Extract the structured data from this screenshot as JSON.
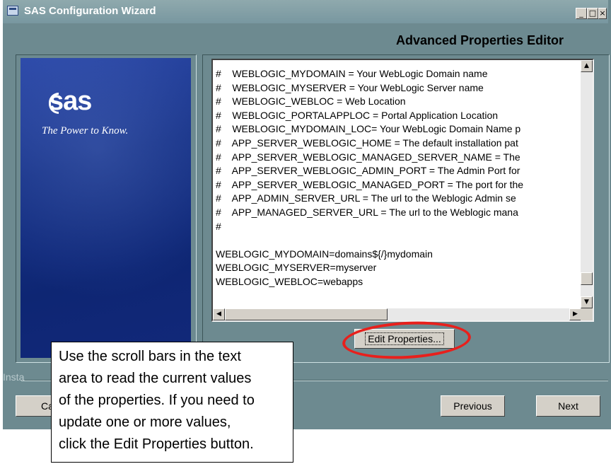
{
  "window": {
    "title": "SAS Configuration Wizard",
    "controls": {
      "minimize": "_",
      "maximize": "□",
      "close": "×"
    }
  },
  "header": {
    "title": "Advanced Properties Editor"
  },
  "banner": {
    "logo_text": "sas",
    "tagline": "The Power to Know."
  },
  "properties_text": {
    "lines": [
      "#    WEBLOGIC_MYDOMAIN = Your WebLogic Domain name",
      "#    WEBLOGIC_MYSERVER = Your WebLogic Server name",
      "#    WEBLOGIC_WEBLOC = Web Location",
      "#    WEBLOGIC_PORTALAPPLOC = Portal Application Location",
      "#    WEBLOGIC_MYDOMAIN_LOC= Your WebLogic Domain Name p",
      "#    APP_SERVER_WEBLOGIC_HOME = The default installation pat",
      "#    APP_SERVER_WEBLOGIC_MANAGED_SERVER_NAME = The",
      "#    APP_SERVER_WEBLOGIC_ADMIN_PORT = The Admin Port for",
      "#    APP_SERVER_WEBLOGIC_MANAGED_PORT = The port for the",
      "#    APP_ADMIN_SERVER_URL = The url to the Weblogic Admin se",
      "#    APP_MANAGED_SERVER_URL = The url to the Weblogic mana",
      "#",
      "",
      "WEBLOGIC_MYDOMAIN=domains${/}mydomain",
      "WEBLOGIC_MYSERVER=myserver",
      "WEBLOGIC_WEBLOC=webapps"
    ]
  },
  "scrollbar": {
    "up_arrow": "▲",
    "down_arrow": "▼",
    "left_arrow": "◀",
    "right_arrow": "▶"
  },
  "buttons": {
    "edit_properties": "Edit Properties...",
    "cancel": "Ca",
    "previous": "Previous",
    "next": "Next"
  },
  "status": {
    "install_label": "Insta"
  },
  "callout": {
    "lines": [
      "Use the scroll bars in the text",
      "area to read the current values",
      "of the properties. If you need to",
      "update one or more values,",
      "click the Edit Properties button."
    ]
  },
  "colors": {
    "window_bg": "#6d8a90",
    "banner_blue": "#173285",
    "highlight_red": "#e8201c"
  }
}
